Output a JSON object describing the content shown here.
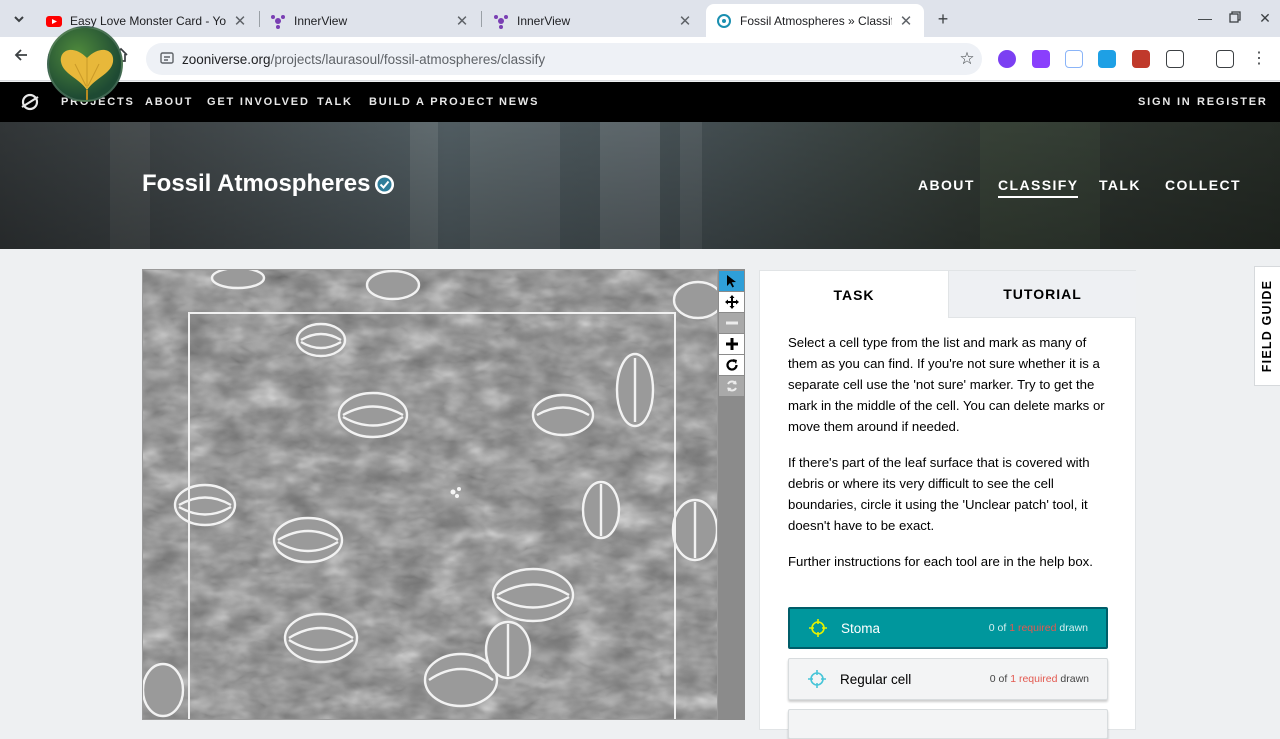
{
  "browser": {
    "tabs": [
      {
        "title": "Easy Love Monster Card - YouT",
        "icon": "youtube-icon",
        "active": false
      },
      {
        "title": "InnerView",
        "icon": "innerview-icon",
        "active": false
      },
      {
        "title": "InnerView",
        "icon": "innerview-icon",
        "active": false
      },
      {
        "title": "Fossil Atmospheres » Classify",
        "icon": "zooniverse-icon",
        "active": true
      }
    ],
    "url_domain": "zooniverse.org",
    "url_path": "/projects/laurasoul/fossil-atmospheres/classify"
  },
  "site_nav": {
    "links": [
      "PROJECTS",
      "ABOUT",
      "GET INVOLVED",
      "TALK",
      "BUILD A PROJECT",
      "NEWS"
    ],
    "sign_in": "SIGN IN",
    "register": "REGISTER"
  },
  "project": {
    "title": "Fossil Atmospheres",
    "nav": [
      "ABOUT",
      "CLASSIFY",
      "TALK",
      "COLLECT"
    ],
    "active_nav": "CLASSIFY"
  },
  "viewer_tools": [
    "select-pointer-icon",
    "pan-icon",
    "zoom-out-icon",
    "zoom-in-icon",
    "rotate-icon",
    "reset-icon"
  ],
  "task_panel": {
    "tabs": [
      "TASK",
      "TUTORIAL"
    ],
    "instructions": [
      "Select a cell type from the list and mark as many of them as you can find. If you're not sure whether it is a separate cell use the 'not sure' marker. Try to get the mark in the middle of the cell. You can delete marks or move them around if needed.",
      "If there's part of the leaf surface that is covered with debris or where its very difficult to see the cell boundaries, circle it using the 'Unclear patch' tool, it doesn't have to be exact.",
      "Further instructions for each tool are in the help box."
    ],
    "tools": [
      {
        "label": "Stoma",
        "count_prefix": "0 of ",
        "required": "1 required",
        "count_suffix": " drawn",
        "icon_color": "#e6f200",
        "active": true
      },
      {
        "label": "Regular cell",
        "count_prefix": "0 of ",
        "required": "1 required",
        "count_suffix": " drawn",
        "icon_color": "#47c5d8",
        "active": false
      }
    ]
  },
  "field_guide": "FIELD GUIDE",
  "colors": {
    "accent_teal": "#00979d",
    "required_red": "#e35950",
    "site_nav_bg": "#000000"
  }
}
